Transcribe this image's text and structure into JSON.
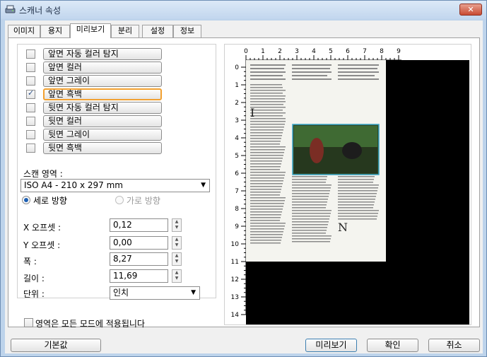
{
  "window": {
    "title": "스캐너 속성",
    "close_label": "✕"
  },
  "tabs": [
    {
      "label": "이미지"
    },
    {
      "label": "용지"
    },
    {
      "label": "미리보기"
    },
    {
      "label": "분리"
    },
    {
      "label": "설정"
    },
    {
      "label": "정보"
    }
  ],
  "active_tab": "미리보기",
  "image_modes": [
    {
      "label": "앞면 자동 컬러 탐지",
      "checked": false
    },
    {
      "label": "앞면 컬러",
      "checked": false
    },
    {
      "label": "앞면 그레이",
      "checked": false
    },
    {
      "label": "앞면 흑백",
      "checked": true,
      "selected": true
    },
    {
      "label": "뒷면 자동 컬러 탐지",
      "checked": false
    },
    {
      "label": "뒷면 컬러",
      "checked": false
    },
    {
      "label": "뒷면 그레이",
      "checked": false
    },
    {
      "label": "뒷면 흑백",
      "checked": false
    }
  ],
  "scan_area": {
    "label": "스캔 영역 :",
    "value": "ISO A4 - 210 x 297 mm",
    "orientation_portrait": "세로 방향",
    "orientation_landscape": "가로 방향",
    "selected_orientation": "portrait"
  },
  "fields": {
    "x_offset": {
      "label": "X 오프셋 :",
      "value": "0,12"
    },
    "y_offset": {
      "label": "Y 오프셋 :",
      "value": "0,00"
    },
    "width": {
      "label": "폭 :",
      "value": "8,27"
    },
    "length": {
      "label": "길이 :",
      "value": "11,69"
    },
    "unit": {
      "label": "단위 :",
      "value": "인치"
    }
  },
  "apply_all_modes": {
    "label": "영역은 모든 모드에 적용됩니다",
    "checked": false
  },
  "ruler": {
    "top_labels": [
      "0",
      "1",
      "2",
      "3",
      "4",
      "5",
      "6",
      "7",
      "8",
      "9"
    ],
    "left_labels": [
      "0",
      "1",
      "2",
      "3",
      "4",
      "5",
      "6",
      "7",
      "8",
      "9",
      "10",
      "11",
      "12",
      "13",
      "14"
    ]
  },
  "buttons": {
    "default": "기본값",
    "preview": "미리보기",
    "ok": "확인",
    "cancel": "취소"
  },
  "colors": {
    "title_bar": "#c2d6ee",
    "close_button": "#c84a32",
    "selected_mode_border": "#f2a030",
    "preview_black": "#000000",
    "photo_frame": "#3aa7c8"
  }
}
